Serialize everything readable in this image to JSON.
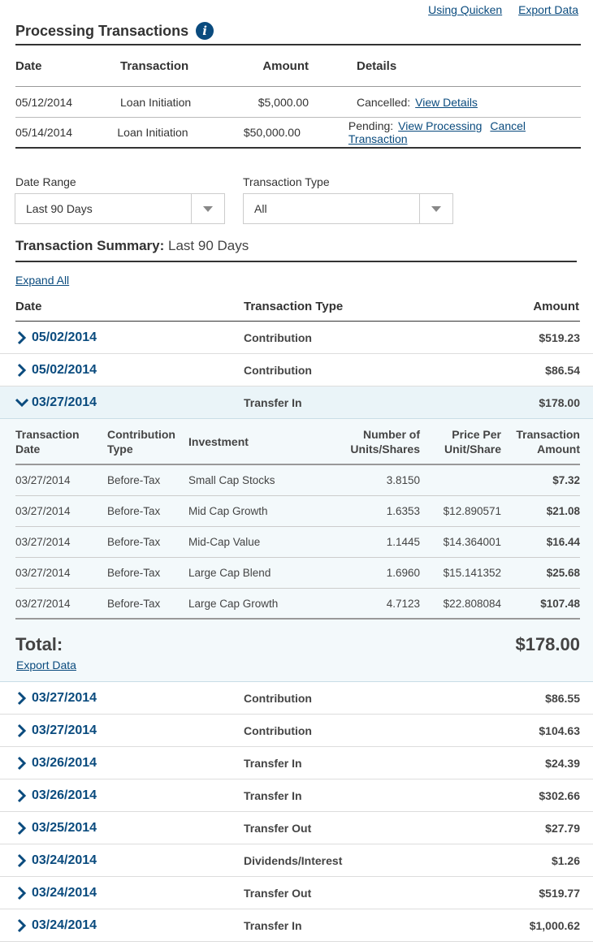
{
  "top_links": {
    "using_quicken": "Using Quicken",
    "export_data": "Export Data"
  },
  "processing": {
    "title": "Processing Transactions",
    "info_icon_label": "i",
    "headers": {
      "date": "Date",
      "transaction": "Transaction",
      "amount": "Amount",
      "details": "Details"
    },
    "rows": [
      {
        "date": "05/12/2014",
        "transaction": "Loan Initiation",
        "amount": "$5,000.00",
        "status": "Cancelled:",
        "link1": "View Details",
        "link2": ""
      },
      {
        "date": "05/14/2014",
        "transaction": "Loan Initiation",
        "amount": "$50,000.00",
        "status": "Pending:",
        "link1": "View Processing",
        "link2": "Cancel Transaction"
      }
    ]
  },
  "filters": {
    "date_range_label": "Date Range",
    "date_range_value": "Last 90 Days",
    "type_label": "Transaction Type",
    "type_value": "All"
  },
  "summary": {
    "title_bold": "Transaction Summary:",
    "title_range": "Last 90 Days",
    "expand_all": "Expand All",
    "headers": {
      "date": "Date",
      "type": "Transaction Type",
      "amount": "Amount"
    },
    "rows_before": [
      {
        "date": "05/02/2014",
        "type": "Contribution",
        "amount": "$519.23"
      },
      {
        "date": "05/02/2014",
        "type": "Contribution",
        "amount": "$86.54"
      }
    ],
    "expanded": {
      "date": "03/27/2014",
      "type": "Transfer In",
      "amount": "$178.00",
      "headers": {
        "tx_date_1": "Transaction",
        "tx_date_2": "Date",
        "ctype_1": "Contribution",
        "ctype_2": "Type",
        "investment": "Investment",
        "units_1": "Number of",
        "units_2": "Units/Shares",
        "price_1": "Price Per",
        "price_2": "Unit/Share",
        "tamt_1": "Transaction",
        "tamt_2": "Amount"
      },
      "rows": [
        {
          "date": "03/27/2014",
          "ctype": "Before-Tax",
          "investment": "Small Cap Stocks",
          "units": "3.8150",
          "price": "",
          "amount": "$7.32"
        },
        {
          "date": "03/27/2014",
          "ctype": "Before-Tax",
          "investment": "Mid Cap Growth",
          "units": "1.6353",
          "price": "$12.890571",
          "amount": "$21.08"
        },
        {
          "date": "03/27/2014",
          "ctype": "Before-Tax",
          "investment": "Mid-Cap Value",
          "units": "1.1445",
          "price": "$14.364001",
          "amount": "$16.44"
        },
        {
          "date": "03/27/2014",
          "ctype": "Before-Tax",
          "investment": "Large Cap Blend",
          "units": "1.6960",
          "price": "$15.141352",
          "amount": "$25.68"
        },
        {
          "date": "03/27/2014",
          "ctype": "Before-Tax",
          "investment": "Large Cap Growth",
          "units": "4.7123",
          "price": "$22.808084",
          "amount": "$107.48"
        }
      ],
      "total_label": "Total:",
      "total_amount": "$178.00",
      "export": "Export Data"
    },
    "rows_after": [
      {
        "date": "03/27/2014",
        "type": "Contribution",
        "amount": "$86.55"
      },
      {
        "date": "03/27/2014",
        "type": "Contribution",
        "amount": "$104.63"
      },
      {
        "date": "03/26/2014",
        "type": "Transfer In",
        "amount": "$24.39"
      },
      {
        "date": "03/26/2014",
        "type": "Transfer In",
        "amount": "$302.66"
      },
      {
        "date": "03/25/2014",
        "type": "Transfer Out",
        "amount": "$27.79"
      },
      {
        "date": "03/24/2014",
        "type": "Dividends/Interest",
        "amount": "$1.26"
      },
      {
        "date": "03/24/2014",
        "type": "Transfer Out",
        "amount": "$519.77"
      },
      {
        "date": "03/24/2014",
        "type": "Transfer In",
        "amount": "$1,000.62"
      }
    ]
  },
  "colors": {
    "link": "#0a4b7e",
    "expanded_bg": "#eaf4f8",
    "detail_bg": "#f3f9fb"
  },
  "icons": {
    "info": "info-icon",
    "collapsed": "chevron-right-icon",
    "expanded": "chevron-down-icon",
    "dropdown": "caret-down-icon"
  }
}
